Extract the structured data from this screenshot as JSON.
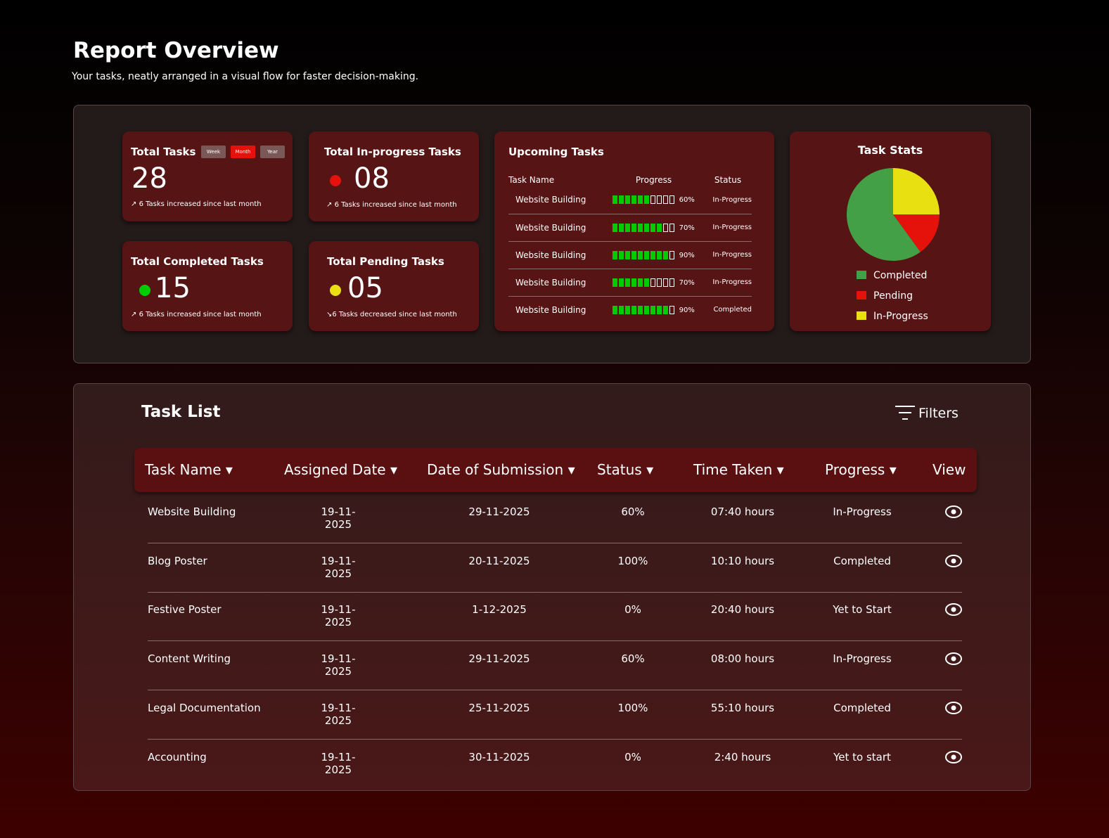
{
  "header": {
    "title": "Report Overview",
    "subtitle": "Your tasks, neatly arranged in a visual flow for faster decision-making."
  },
  "stats": {
    "total": {
      "title": "Total Tasks",
      "value": "28",
      "note": "6 Tasks increased since last month",
      "periods": [
        "Week",
        "Month",
        "Year"
      ],
      "active_period": "Month"
    },
    "in_progress": {
      "title": "Total In-progress Tasks",
      "value": "08",
      "note": "6 Tasks increased since last month"
    },
    "completed": {
      "title": "Total Completed Tasks",
      "value": "15",
      "note": "6 Tasks increased since last month"
    },
    "pending": {
      "title": "Total Pending Tasks",
      "value": "05",
      "note": "6 Tasks decreased since last month"
    }
  },
  "upcoming": {
    "title": "Upcoming Tasks",
    "headers": [
      "Task Name",
      "Progress",
      "Status"
    ],
    "rows": [
      {
        "name": "Website Building",
        "filled": 6,
        "pct": "60%",
        "status": "In-Progress"
      },
      {
        "name": "Website Building",
        "filled": 8,
        "pct": "70%",
        "status": "In-Progress"
      },
      {
        "name": "Website Building",
        "filled": 9,
        "pct": "90%",
        "status": "In-Progress"
      },
      {
        "name": "Website Building",
        "filled": 6,
        "pct": "70%",
        "status": "In-Progress"
      },
      {
        "name": "Website Building",
        "filled": 9,
        "pct": "90%",
        "status": "Completed"
      }
    ]
  },
  "task_stats": {
    "title": "Task Stats",
    "slices": [
      {
        "label": "Completed",
        "value": 60,
        "color": "#43a047"
      },
      {
        "label": "Pending",
        "value": 15,
        "color": "#e5120c"
      },
      {
        "label": "In-Progress",
        "value": 25,
        "color": "#e8e010"
      }
    ]
  },
  "task_list": {
    "title": "Task List",
    "filters": "Filters",
    "headers": [
      "Task Name",
      "Assigned Date",
      "Date of Submission",
      "Status",
      "Time Taken",
      "Progress",
      "View"
    ],
    "rows": [
      [
        "Website Building",
        "19-11-2025",
        "29-11-2025",
        "60%",
        "07:40 hours",
        "In-Progress"
      ],
      [
        "Blog Poster",
        "19-11-2025",
        "20-11-2025",
        "100%",
        "10:10 hours",
        "Completed"
      ],
      [
        "Festive Poster",
        "19-11-2025",
        "1-12-2025",
        "0%",
        "20:40 hours",
        "Yet to Start"
      ],
      [
        "Content Writing",
        "19-11-2025",
        "29-11-2025",
        "60%",
        "08:00 hours",
        "In-Progress"
      ],
      [
        "Legal Documentation",
        "19-11-2025",
        "25-11-2025",
        "100%",
        "55:10 hours",
        "Completed"
      ],
      [
        "Accounting",
        "19-11-2025",
        "30-11-2025",
        "0%",
        "2:40 hours",
        "Yet to start"
      ]
    ]
  }
}
